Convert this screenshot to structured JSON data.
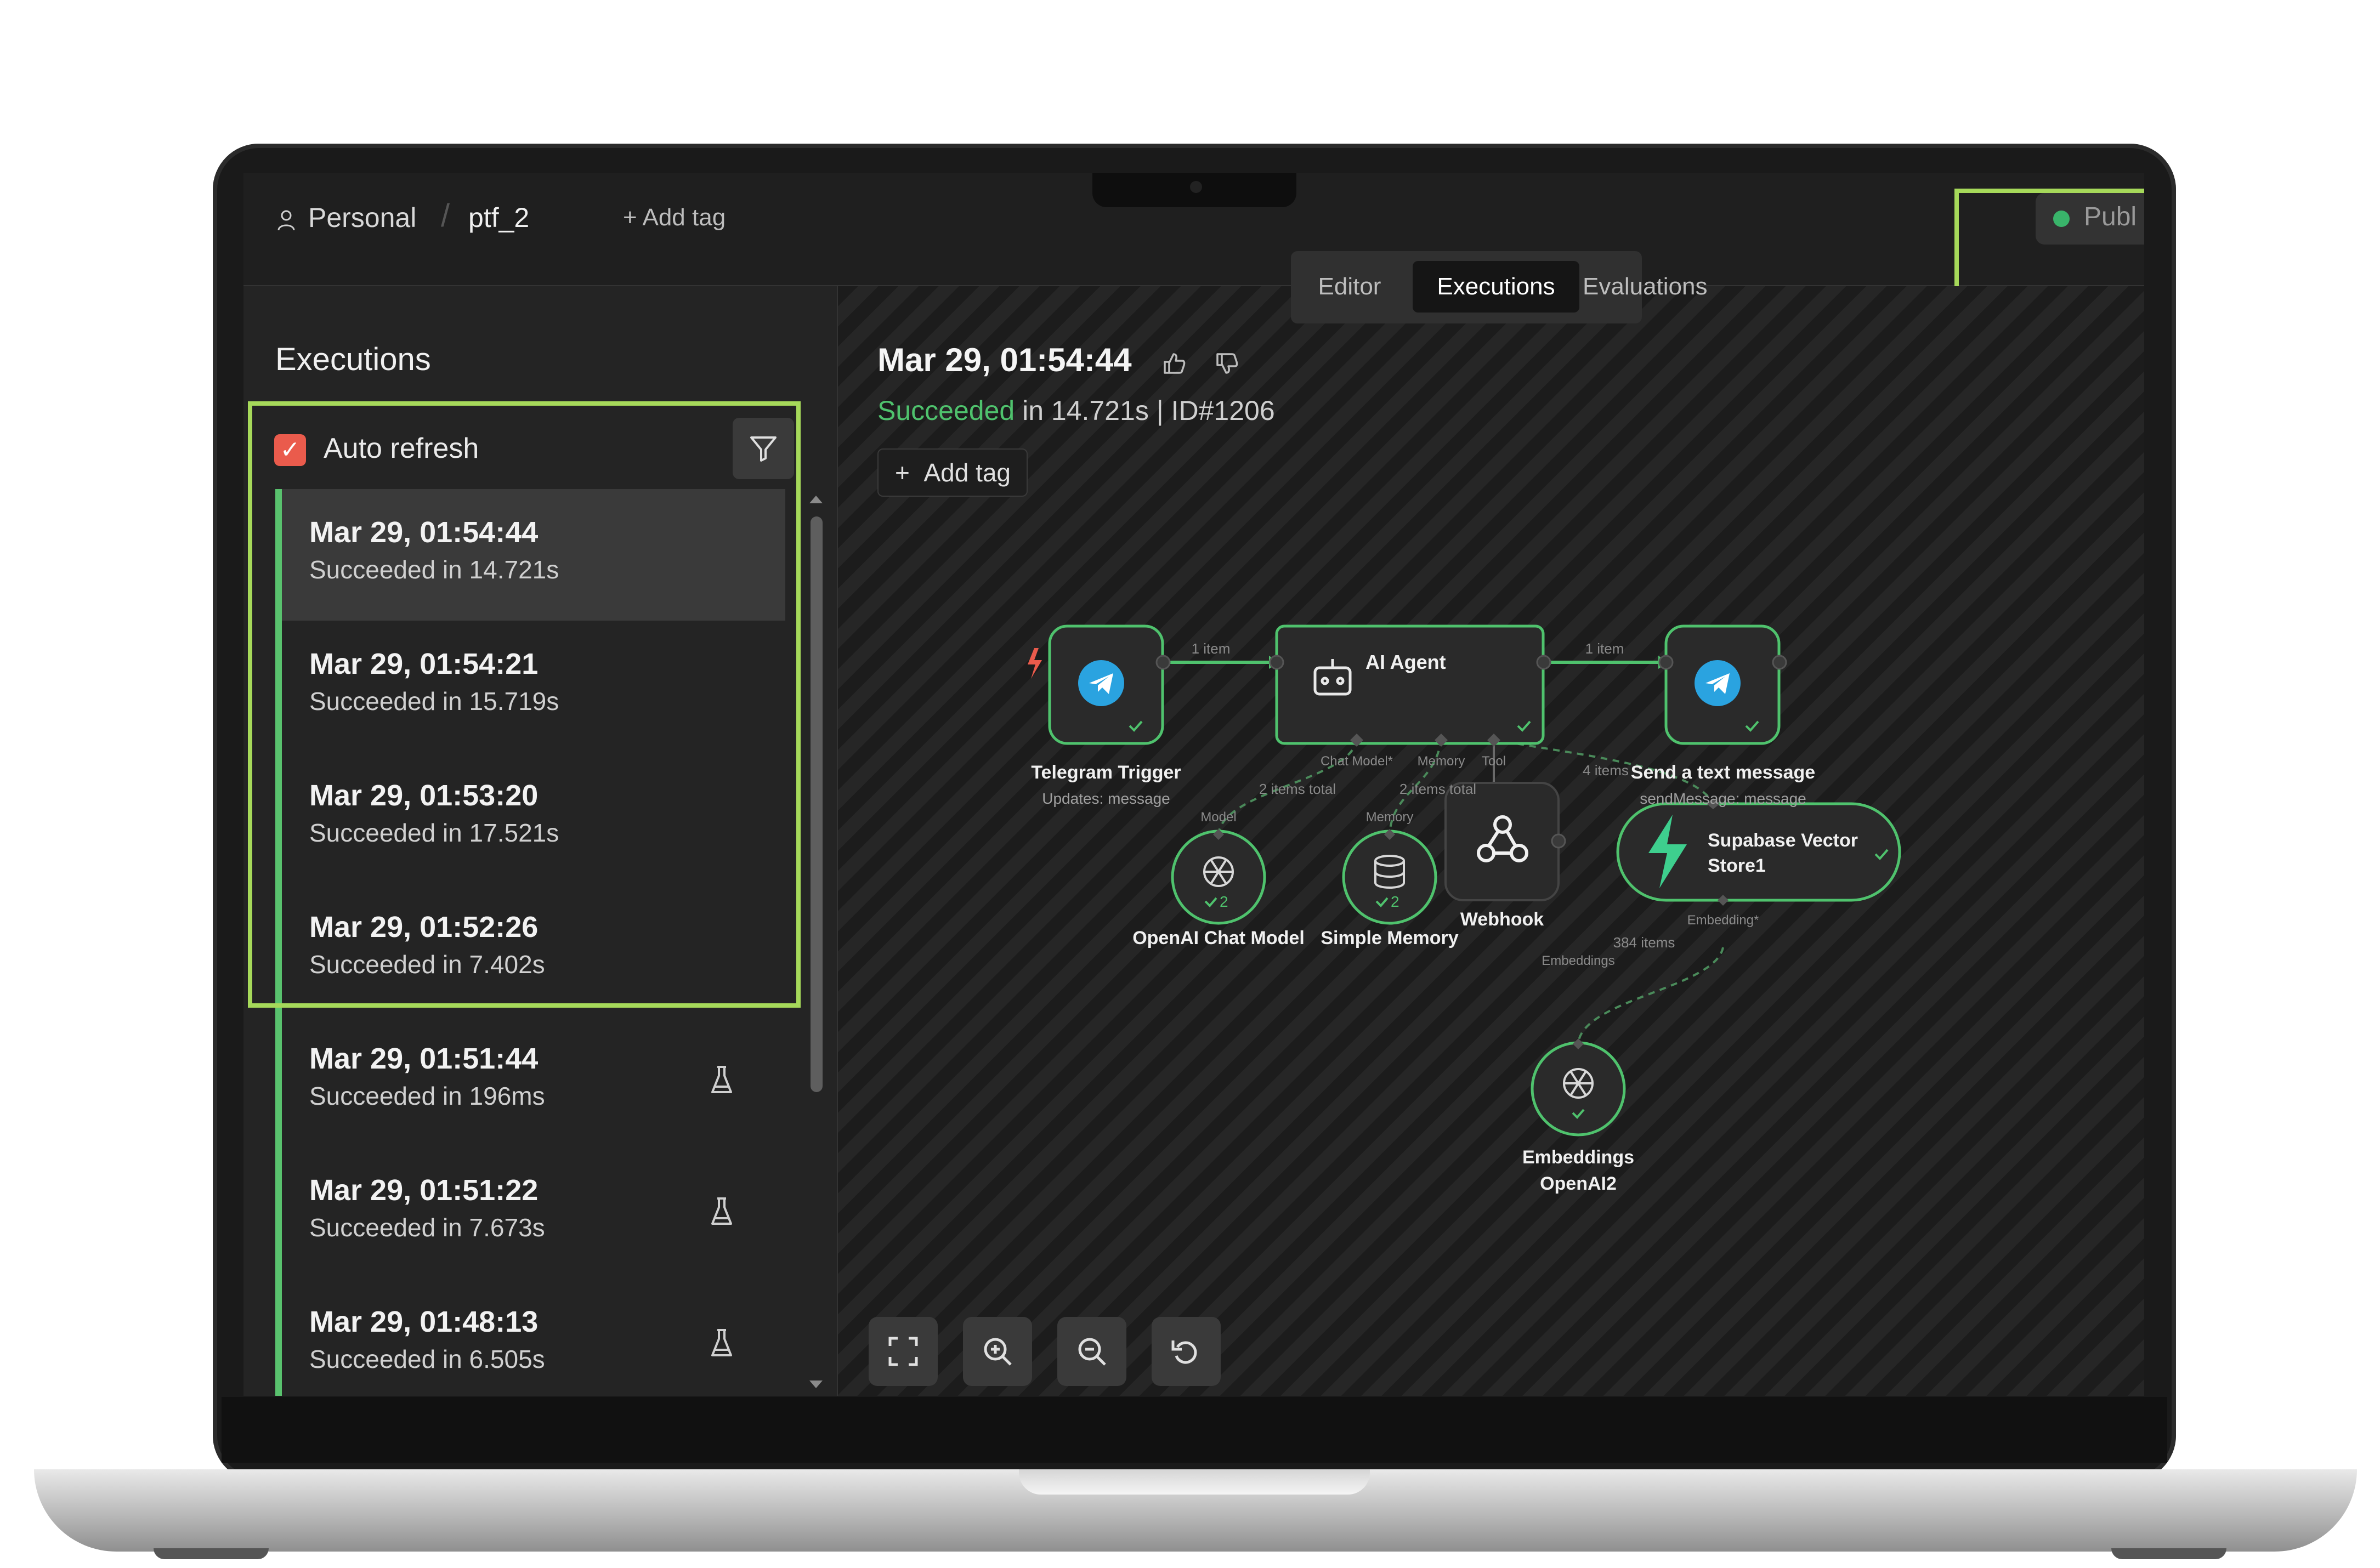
{
  "header": {
    "project": "Personal",
    "workflow": "ptf_2",
    "add_tag": "+ Add tag",
    "publish": "Publ"
  },
  "tabs": [
    {
      "label": "Editor",
      "active": false
    },
    {
      "label": "Executions",
      "active": true
    },
    {
      "label": "Evaluations",
      "active": false
    }
  ],
  "sidebar": {
    "title": "Executions",
    "auto_refresh": {
      "label": "Auto refresh",
      "checked": true
    },
    "executions": [
      {
        "time": "Mar 29, 01:54:44",
        "status": "Succeeded in 14.721s",
        "selected": true,
        "test": false
      },
      {
        "time": "Mar 29, 01:54:21",
        "status": "Succeeded in 15.719s",
        "selected": false,
        "test": false
      },
      {
        "time": "Mar 29, 01:53:20",
        "status": "Succeeded in 17.521s",
        "selected": false,
        "test": false
      },
      {
        "time": "Mar 29, 01:52:26",
        "status": "Succeeded in 7.402s",
        "selected": false,
        "test": false
      },
      {
        "time": "Mar 29, 01:51:44",
        "status": "Succeeded in 196ms",
        "selected": false,
        "test": true
      },
      {
        "time": "Mar 29, 01:51:22",
        "status": "Succeeded in 7.673s",
        "selected": false,
        "test": true
      },
      {
        "time": "Mar 29, 01:48:13",
        "status": "Succeeded in 6.505s",
        "selected": false,
        "test": true
      }
    ]
  },
  "execution": {
    "date": "Mar 29, 01:54:44",
    "status_word": "Succeeded",
    "status_rest": " in 14.721s | ID#1206",
    "add_tag": "Add tag"
  },
  "nodes": {
    "telegram_trigger": {
      "title": "Telegram Trigger",
      "subtitle": "Updates: message"
    },
    "ai_agent": {
      "title": "AI Agent"
    },
    "send_message": {
      "title": "Send a text message",
      "subtitle": "sendMessage: message"
    },
    "openai_chat": {
      "title": "OpenAI Chat Model",
      "count": "2"
    },
    "simple_memory": {
      "title": "Simple Memory",
      "count": "2"
    },
    "webhook": {
      "title": "Webhook"
    },
    "supabase": {
      "title_line1": "Supabase Vector",
      "title_line2": "Store1"
    },
    "embeddings": {
      "title_line1": "Embeddings",
      "title_line2": "OpenAI2"
    }
  },
  "edge_labels": {
    "trigger_to_agent": "1 item",
    "agent_to_send": "1 item",
    "chat_model_port": "Chat Model*",
    "memory_port": "Memory",
    "tool_port": "Tool",
    "model_items": "2 items total",
    "memory_items": "2 items total",
    "tool_items": "4 items",
    "model_label": "Model",
    "memory_label": "Memory",
    "embedding_port": "Embedding*",
    "embedding_items": "384 items",
    "embeddings_label": "Embeddings"
  },
  "colors": {
    "success": "#4fc26d",
    "highlight": "#a6d95a",
    "telegram": "#2aa3e0",
    "checkbox": "#ea5b4c",
    "trigger_bolt": "#ea5b4c"
  },
  "icons": [
    "person-icon",
    "filter-icon",
    "flask-icon",
    "thumbs-up-icon",
    "thumbs-down-icon",
    "telegram-icon",
    "robot-icon",
    "openai-icon",
    "database-icon",
    "webhook-icon",
    "supabase-icon",
    "fit-view-icon",
    "zoom-in-icon",
    "zoom-out-icon",
    "reset-icon"
  ]
}
